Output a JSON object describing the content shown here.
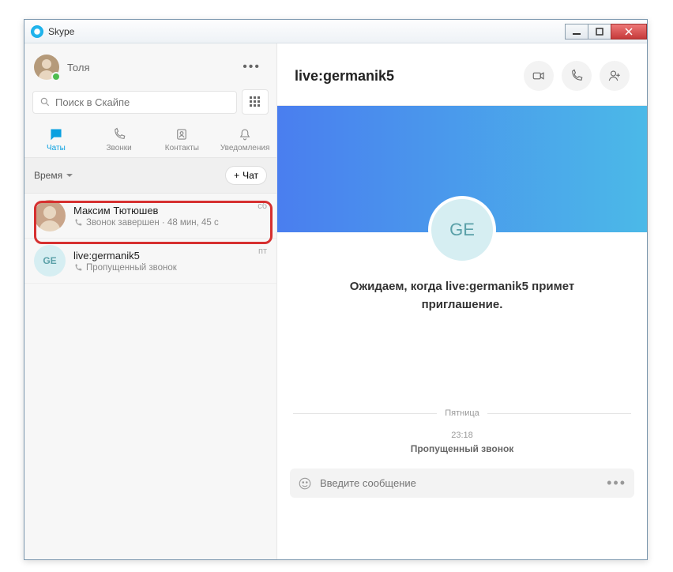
{
  "window": {
    "title": "Skype"
  },
  "profile": {
    "name": "Толя"
  },
  "search": {
    "placeholder": "Поиск в Скайпе"
  },
  "tabs": {
    "chats": "Чаты",
    "calls": "Звонки",
    "contacts": "Контакты",
    "notifications": "Уведомления"
  },
  "listheader": {
    "sort": "Время",
    "newchat": "Чат"
  },
  "chats": [
    {
      "name": "Максим Тютюшев",
      "sub": "Звонок завершен · 48 мин, 45 с",
      "time": "сб"
    },
    {
      "name": "live:germanik5",
      "sub": "Пропущенный звонок",
      "time": "пт",
      "initials": "GE"
    }
  ],
  "main": {
    "title": "live:germanik5",
    "avatar_initials": "GE",
    "waiting": "Ожидаем, когда live:germanik5 примет приглашение.",
    "day": "Пятница",
    "msg_time": "23:18",
    "msg_text": "Пропущенный звонок",
    "composer_placeholder": "Введите сообщение"
  }
}
